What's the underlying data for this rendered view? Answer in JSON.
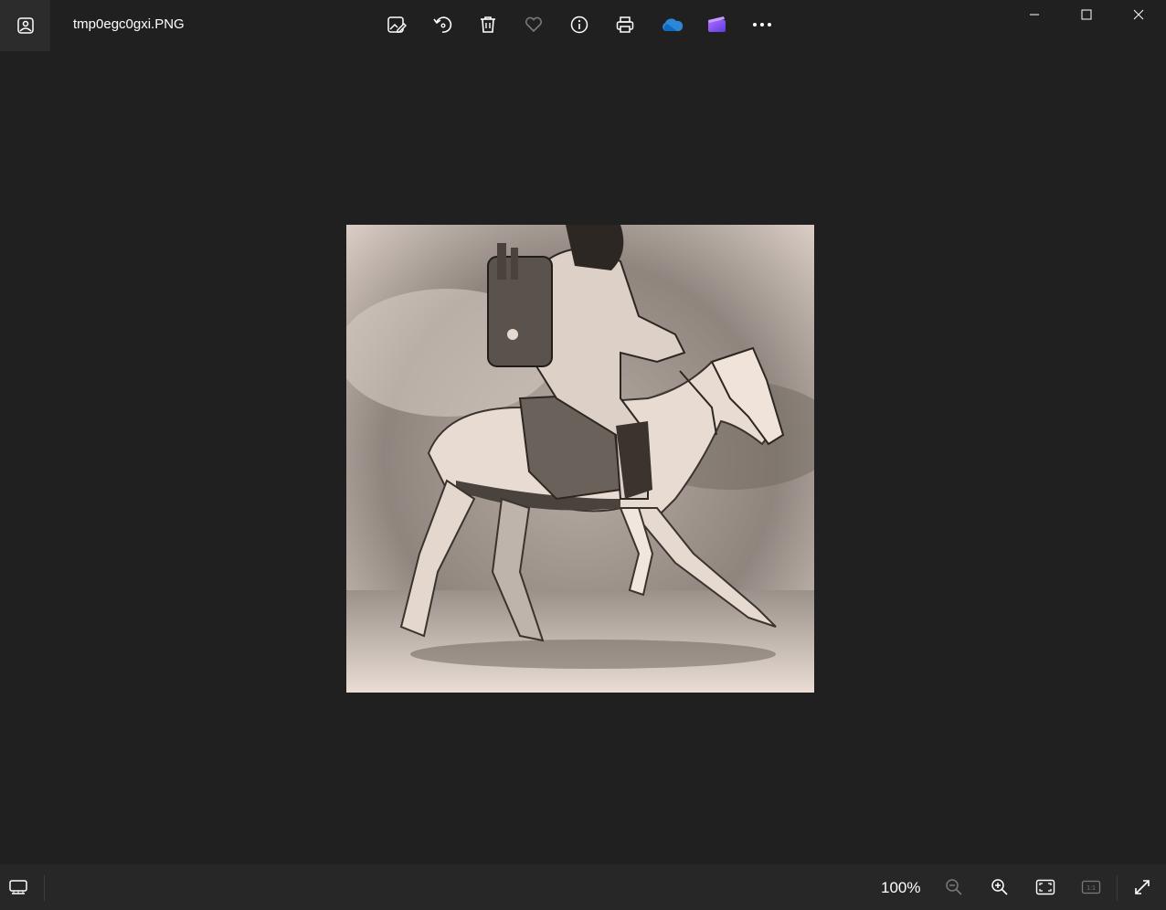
{
  "window": {
    "file_name": "tmp0egc0gxi.PNG"
  },
  "toolbar": {
    "icons": [
      "edit-image-icon",
      "rotate-icon",
      "delete-icon",
      "favorite-icon",
      "info-icon",
      "print-icon",
      "onedrive-icon",
      "clipchamp-icon",
      "more-icon"
    ]
  },
  "image": {
    "description_icon": "astronaut-riding-horse-photo"
  },
  "statusbar": {
    "zoom_level": "100%"
  },
  "colors": {
    "background": "#202020",
    "statusbar": "#272727",
    "onedrive_blue": "#2b88d8",
    "clipchamp_purple": "#8a4dff"
  }
}
